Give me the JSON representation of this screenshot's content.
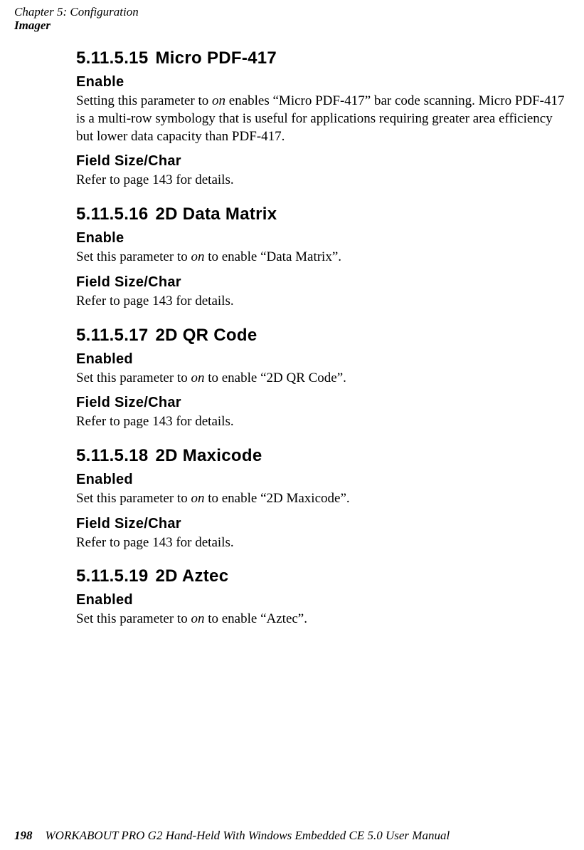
{
  "header": {
    "chapter_line": "Chapter 5: Configuration",
    "section_line": "Imager"
  },
  "sections": {
    "s15": {
      "number": "5.11.5.15",
      "title": "Micro PDF-417",
      "enable_label": "Enable",
      "enable_body_pre": "Setting this parameter to ",
      "enable_body_em": "on",
      "enable_body_post": " enables “Micro PDF-417” bar code scanning. Micro PDF-417 is a multi-row symbology that is useful for applications requiring greater area efficiency but lower data capacity than PDF-417.",
      "fieldsize_label": "Field Size/Char",
      "fieldsize_body": "Refer to page 143 for details."
    },
    "s16": {
      "number": "5.11.5.16",
      "title": "2D Data Matrix",
      "enable_label": "Enable",
      "enable_body_pre": "Set this parameter to ",
      "enable_body_em": "on",
      "enable_body_post": " to enable “Data Matrix”.",
      "fieldsize_label": "Field Size/Char",
      "fieldsize_body": "Refer to page 143 for details."
    },
    "s17": {
      "number": "5.11.5.17",
      "title": "2D QR Code",
      "enable_label": "Enabled",
      "enable_body_pre": "Set this parameter to ",
      "enable_body_em": "on",
      "enable_body_post": " to enable “2D QR Code”.",
      "fieldsize_label": "Field Size/Char",
      "fieldsize_body": "Refer to page 143 for details."
    },
    "s18": {
      "number": "5.11.5.18",
      "title": "2D Maxicode",
      "enable_label": "Enabled",
      "enable_body_pre": "Set this parameter to ",
      "enable_body_em": "on",
      "enable_body_post": " to enable “2D Maxicode”.",
      "fieldsize_label": "Field Size/Char",
      "fieldsize_body": "Refer to page 143 for details."
    },
    "s19": {
      "number": "5.11.5.19",
      "title": "2D Aztec",
      "enable_label": "Enabled",
      "enable_body_pre": "Set this parameter to ",
      "enable_body_em": "on",
      "enable_body_post": " to enable “Aztec”."
    }
  },
  "footer": {
    "page_number": "198",
    "manual_title": "WORKABOUT PRO G2 Hand-Held With Windows Embedded CE 5.0 User Manual"
  }
}
